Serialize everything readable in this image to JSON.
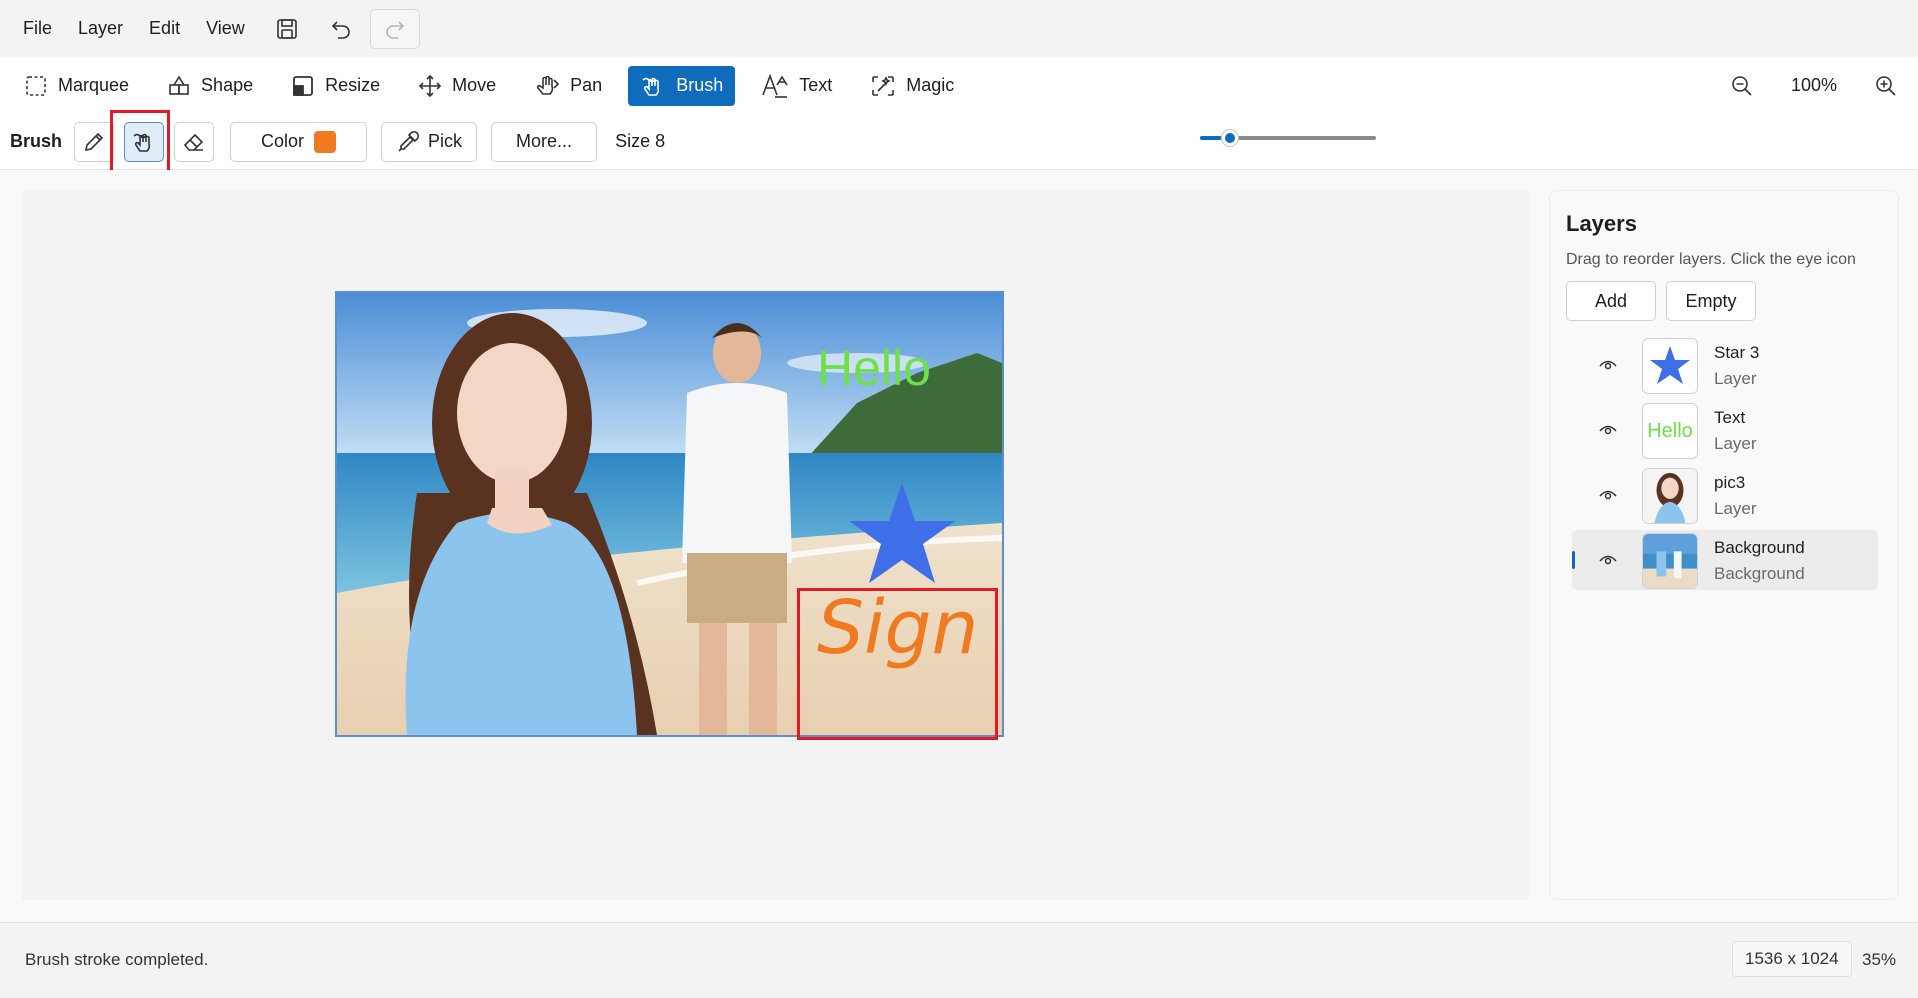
{
  "menu": {
    "items": [
      "File",
      "Layer",
      "Edit",
      "View"
    ],
    "icons": [
      "save-icon",
      "undo-icon",
      "redo-icon"
    ]
  },
  "toolbar": {
    "tools": [
      {
        "label": "Marquee",
        "icon": "marquee-icon"
      },
      {
        "label": "Shape",
        "icon": "shape-icon"
      },
      {
        "label": "Resize",
        "icon": "resize-icon"
      },
      {
        "label": "Move",
        "icon": "move-icon"
      },
      {
        "label": "Pan",
        "icon": "pan-icon"
      },
      {
        "label": "Brush",
        "icon": "brush-icon",
        "active": true
      },
      {
        "label": "Text",
        "icon": "text-icon"
      },
      {
        "label": "Magic",
        "icon": "magic-icon"
      }
    ],
    "zoom": "100%"
  },
  "options": {
    "label": "Brush",
    "color_label": "Color",
    "color_value": "#f07a1f",
    "pick_label": "Pick",
    "more_label": "More...",
    "size_label": "Size 8",
    "size_fraction": 0.12
  },
  "canvas": {
    "text_overlay": "Hello",
    "sign_text": "Sign"
  },
  "layers": {
    "title": "Layers",
    "hint": "Drag to reorder layers. Click the eye icon",
    "add_label": "Add",
    "empty_label": "Empty",
    "items": [
      {
        "name": "Star 3",
        "type": "Layer"
      },
      {
        "name": "Text",
        "type": "Layer",
        "thumb_text": "Hello"
      },
      {
        "name": "pic3",
        "type": "Layer"
      },
      {
        "name": "Background",
        "type": "Background",
        "selected": true
      }
    ]
  },
  "status": {
    "message": "Brush stroke completed.",
    "dimensions": "1536 x 1024",
    "zoom": "35%"
  },
  "colors": {
    "accent": "#0f6cbd",
    "highlight": "#e01b24",
    "hello_green": "#6de04a",
    "star_blue": "#3f6fe8"
  }
}
